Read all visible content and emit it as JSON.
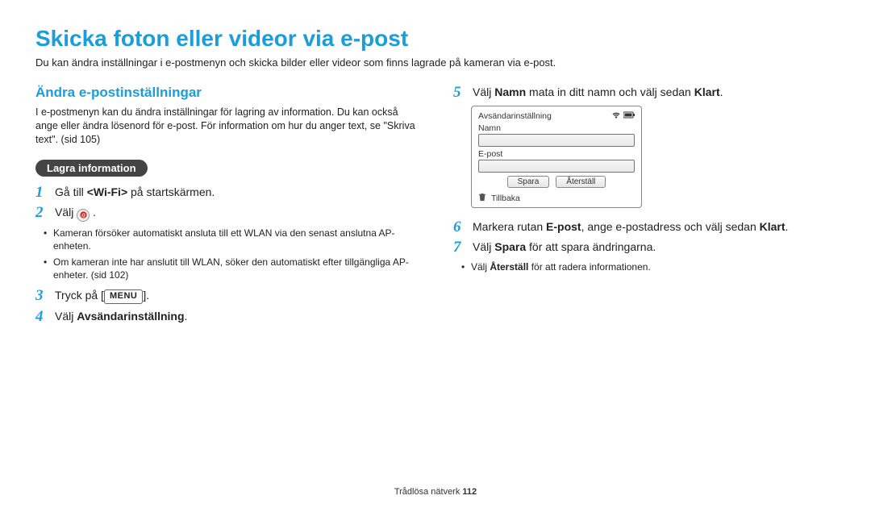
{
  "title": "Skicka foton eller videor via e-post",
  "intro": "Du kan ändra inställningar i e-postmenyn och skicka bilder eller videor som finns lagrade på kameran via e-post.",
  "section_heading": "Ändra e-postinställningar",
  "section_text": "I e-postmenyn kan du ändra inställningar för lagring av information. Du kan också ange eller ändra lösenord för e-post. För information om hur du anger text, se \"Skriva text\". (sid 105)",
  "pill_label": "Lagra information",
  "steps_left": {
    "s1_pre": "Gå till ",
    "s1_bold": "<Wi-Fi>",
    "s1_post": " på startskärmen.",
    "s2_pre": "Välj ",
    "s2_post": " .",
    "b1": "Kameran försöker automatiskt ansluta till ett WLAN via den senast anslutna AP-enheten.",
    "b2": "Om kameran inte har anslutit till WLAN, söker den automatiskt efter tillgängliga AP-enheter. (sid 102)",
    "s3_pre": "Tryck på [",
    "s3_menu": "MENU",
    "s3_post": "].",
    "s4_pre": "Välj ",
    "s4_bold": "Avsändarinställning",
    "s4_post": "."
  },
  "steps_right": {
    "s5_pre": "Välj ",
    "s5_b1": "Namn",
    "s5_mid": " mata in ditt namn och välj sedan ",
    "s5_b2": "Klart",
    "s5_post": ".",
    "s6_pre": "Markera rutan ",
    "s6_b1": "E-post",
    "s6_mid": ", ange e-postadress och välj sedan ",
    "s6_b2": "Klart",
    "s6_post": ".",
    "s7_pre": "Välj ",
    "s7_b1": "Spara",
    "s7_post": " för att spara ändringarna.",
    "s7_bullet_pre": "Välj ",
    "s7_bullet_b": "Återställ",
    "s7_bullet_post": " för att radera informationen."
  },
  "device": {
    "title": "Avsändarinställning",
    "namn_label": "Namn",
    "epost_label": "E-post",
    "btn_save": "Spara",
    "btn_reset": "Återställ",
    "back": "Tillbaka"
  },
  "footer_text": "Trådlösa nätverk ",
  "footer_page": "112",
  "numbers": {
    "n1": "1",
    "n2": "2",
    "n3": "3",
    "n4": "4",
    "n5": "5",
    "n6": "6",
    "n7": "7"
  }
}
